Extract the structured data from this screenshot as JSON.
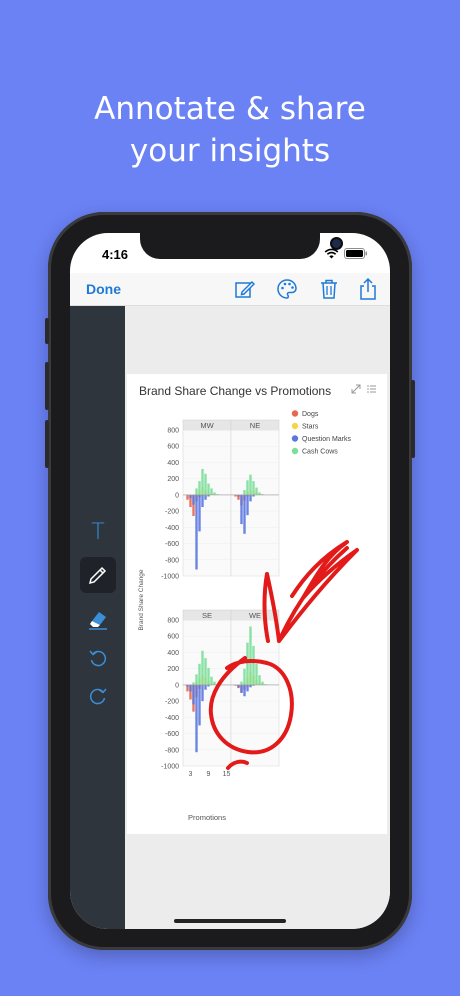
{
  "headline": {
    "line1": "Annotate & share",
    "line2": "your insights"
  },
  "status": {
    "time": "4:16"
  },
  "toolbar": {
    "done_label": "Done",
    "icons": [
      "compose-icon",
      "palette-icon",
      "trash-icon",
      "share-icon"
    ]
  },
  "sidebar": {
    "tools": [
      "text-tool-icon",
      "pen-icon",
      "eraser-icon",
      "undo-icon",
      "redo-icon"
    ],
    "active_tool": "pen-icon",
    "text_tool_glyph": "T"
  },
  "colors": {
    "background": "#6b82f5",
    "accent": "#1e7ad6",
    "annotation": "#e21a1a",
    "dogs": "#e8674f",
    "stars": "#f7d54a",
    "question_marks": "#5b78e0",
    "cash_cows": "#7bdf9a"
  },
  "card": {
    "title": "Brand Share Change vs Promotions"
  },
  "chart_data": {
    "type": "bar",
    "title": "Brand Share Change vs Promotions",
    "xlabel": "Promotions",
    "ylabel": "Brand Share Change",
    "ylim": [
      -1000,
      800
    ],
    "yticks": [
      "800",
      "600",
      "400",
      "200",
      "0",
      "-200",
      "-400",
      "-600",
      "-800",
      "-1000"
    ],
    "xticks": [
      "3",
      "9",
      "15"
    ],
    "x": [
      1,
      2,
      3,
      4,
      5,
      6,
      7,
      8,
      9,
      10,
      11,
      12,
      13,
      14,
      15,
      16
    ],
    "legend": [
      "Dogs",
      "Stars",
      "Question Marks",
      "Cash Cows"
    ],
    "legend_position": "top-right",
    "panels": [
      {
        "label": "MW",
        "series": [
          {
            "name": "Dogs",
            "values": [
              0,
              -60,
              -150,
              -260,
              -80,
              -30,
              -10,
              0,
              0,
              0,
              0,
              0,
              0,
              0,
              0,
              0
            ]
          },
          {
            "name": "Stars",
            "values": [
              0,
              0,
              0,
              0,
              20,
              60,
              90,
              60,
              40,
              20,
              10,
              0,
              0,
              0,
              0,
              0
            ]
          },
          {
            "name": "Question Marks",
            "values": [
              0,
              0,
              -40,
              -120,
              -920,
              -450,
              -150,
              -60,
              -20,
              0,
              0,
              0,
              0,
              0,
              0,
              0
            ]
          },
          {
            "name": "Cash Cows",
            "values": [
              0,
              0,
              0,
              0,
              80,
              170,
              320,
              260,
              140,
              80,
              30,
              10,
              0,
              0,
              0,
              0
            ]
          }
        ]
      },
      {
        "label": "NE",
        "series": [
          {
            "name": "Dogs",
            "values": [
              0,
              -20,
              -60,
              -130,
              -70,
              -20,
              0,
              0,
              0,
              0,
              0,
              0,
              0,
              0,
              0,
              0
            ]
          },
          {
            "name": "Stars",
            "values": [
              0,
              0,
              0,
              0,
              10,
              40,
              60,
              50,
              30,
              10,
              0,
              0,
              0,
              0,
              0,
              0
            ]
          },
          {
            "name": "Question Marks",
            "values": [
              0,
              0,
              -20,
              -360,
              -480,
              -250,
              -80,
              -20,
              0,
              0,
              0,
              0,
              0,
              0,
              0,
              0
            ]
          },
          {
            "name": "Cash Cows",
            "values": [
              0,
              0,
              0,
              0,
              60,
              180,
              250,
              170,
              90,
              30,
              10,
              0,
              0,
              0,
              0,
              0
            ]
          }
        ]
      },
      {
        "label": "SE",
        "series": [
          {
            "name": "Dogs",
            "values": [
              0,
              -80,
              -180,
              -330,
              -150,
              -50,
              -10,
              0,
              0,
              0,
              0,
              0,
              0,
              0,
              0,
              0
            ]
          },
          {
            "name": "Stars",
            "values": [
              0,
              0,
              0,
              10,
              40,
              80,
              120,
              90,
              50,
              20,
              10,
              0,
              0,
              0,
              0,
              0
            ]
          },
          {
            "name": "Question Marks",
            "values": [
              0,
              -20,
              -80,
              -240,
              -830,
              -500,
              -200,
              -60,
              -20,
              0,
              0,
              0,
              0,
              0,
              0,
              0
            ]
          },
          {
            "name": "Cash Cows",
            "values": [
              0,
              0,
              0,
              30,
              130,
              260,
              420,
              330,
              210,
              100,
              40,
              10,
              0,
              0,
              0,
              0
            ]
          }
        ]
      },
      {
        "label": "WE",
        "series": [
          {
            "name": "Dogs",
            "values": [
              0,
              -10,
              -40,
              -90,
              -60,
              -20,
              -10,
              0,
              0,
              0,
              0,
              0,
              0,
              0,
              0,
              0
            ]
          },
          {
            "name": "Stars",
            "values": [
              0,
              0,
              0,
              0,
              30,
              90,
              160,
              110,
              60,
              30,
              10,
              0,
              0,
              0,
              0,
              0
            ]
          },
          {
            "name": "Question Marks",
            "values": [
              0,
              0,
              -30,
              -100,
              -140,
              -80,
              -30,
              -10,
              0,
              0,
              0,
              0,
              0,
              0,
              0,
              0
            ]
          },
          {
            "name": "Cash Cows",
            "values": [
              0,
              0,
              0,
              40,
              200,
              520,
              720,
              480,
              260,
              120,
              40,
              10,
              0,
              0,
              0,
              0
            ]
          }
        ]
      }
    ]
  }
}
